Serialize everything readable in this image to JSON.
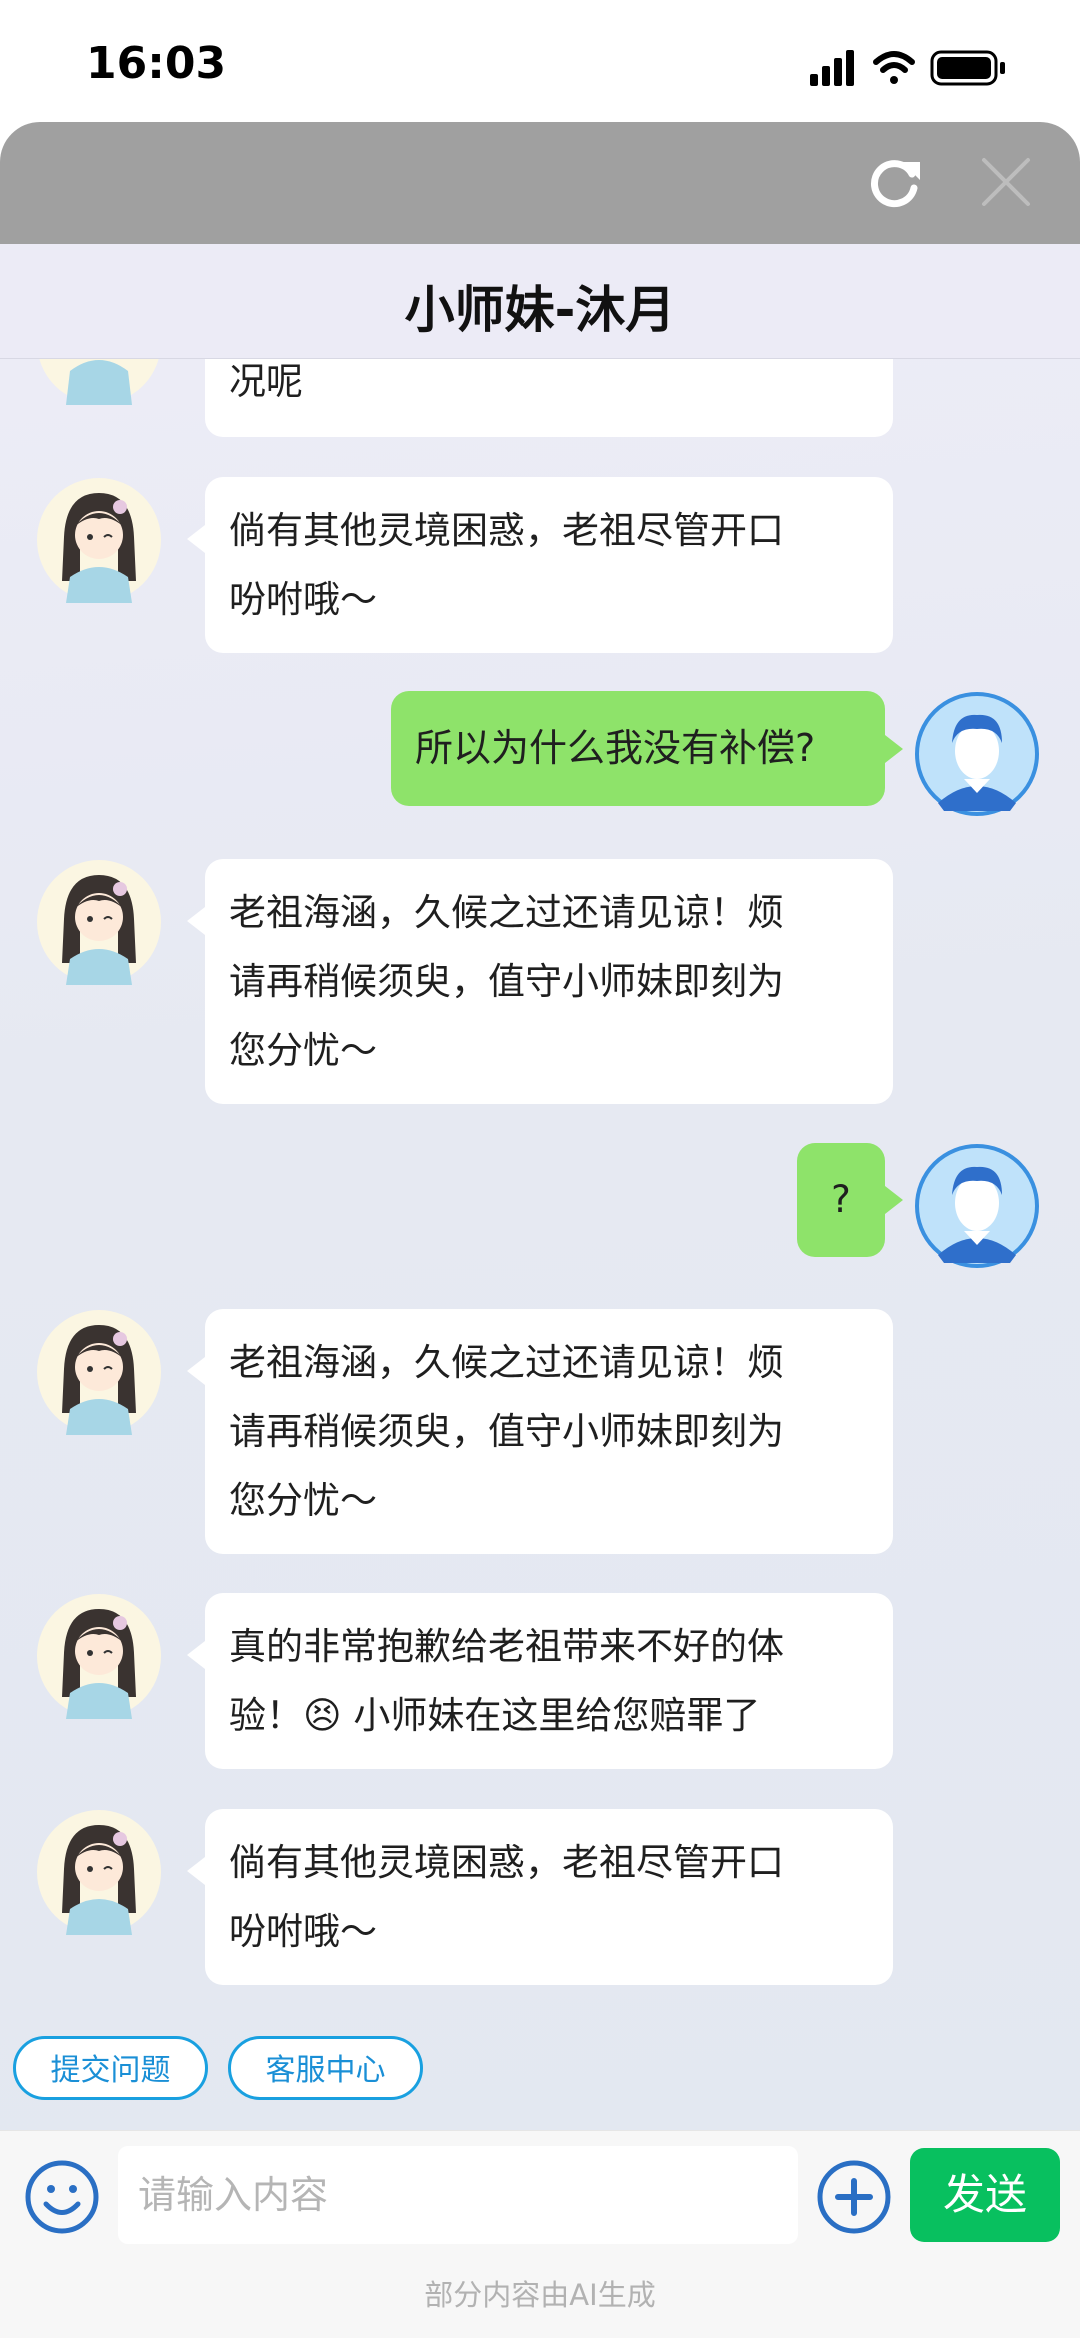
{
  "status_bar": {
    "time": "16:03"
  },
  "header": {
    "title": "小师妹-沐月"
  },
  "messages": [
    {
      "from": "agent",
      "lines": [
        "况呢"
      ]
    },
    {
      "from": "agent",
      "lines": [
        "倘有其他灵境困惑，老祖尽管开口",
        "吩咐哦～"
      ]
    },
    {
      "from": "user",
      "lines": [
        "所以为什么我没有补偿?"
      ]
    },
    {
      "from": "agent",
      "lines": [
        "老祖海涵，久候之过还请见谅！烦",
        "请再稍候须臾，值守小师妹即刻为",
        "您分忧～"
      ]
    },
    {
      "from": "user",
      "lines": [
        "?"
      ]
    },
    {
      "from": "agent",
      "lines": [
        "老祖海涵，久候之过还请见谅！烦",
        "请再稍候须臾，值守小师妹即刻为",
        "您分忧～"
      ]
    },
    {
      "from": "agent",
      "lines": [
        "真的非常抱歉给老祖带来不好的体",
        "验！😣 小师妹在这里给您赔罪了"
      ]
    },
    {
      "from": "agent",
      "lines": [
        "倘有其他灵境困惑，老祖尽管开口",
        "吩咐哦～"
      ]
    }
  ],
  "quick_actions": [
    "提交问题",
    "客服中心"
  ],
  "input": {
    "placeholder": "请输入内容",
    "value": ""
  },
  "send_label": "发送",
  "footer_note": "部分内容由AI生成",
  "colors": {
    "send": "#08c05f",
    "user_bubble": "#8ee36a",
    "quick_border": "#19a0e0"
  },
  "icons": [
    "refresh-icon",
    "close-icon",
    "emoji-icon",
    "plus-circle-icon",
    "signal-icon",
    "wifi-icon",
    "battery-icon"
  ]
}
